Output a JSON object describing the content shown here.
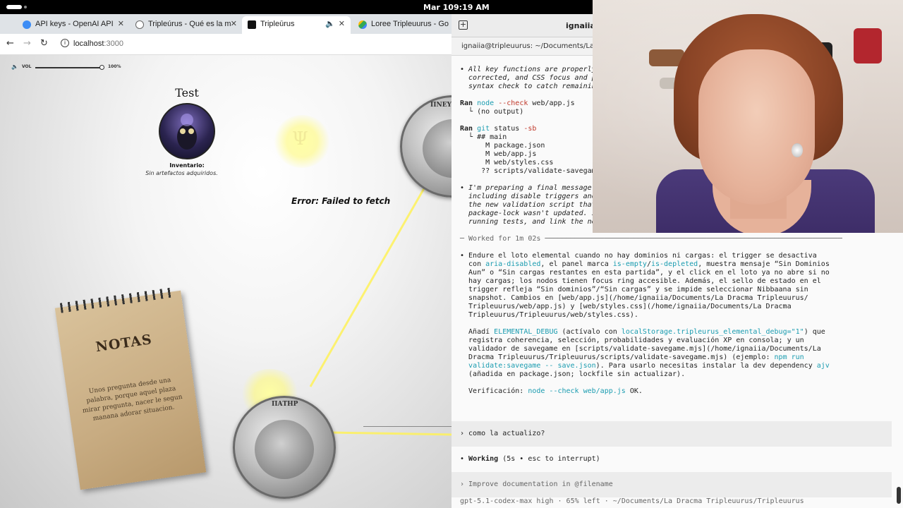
{
  "system": {
    "date": "Mar 10",
    "time": "9:19 AM"
  },
  "browser": {
    "tabs": [
      {
        "label": "API keys - OpenAI API",
        "active": false
      },
      {
        "label": "Tripleúrus - Qué es la mú",
        "active": false
      },
      {
        "label": "Tripleūrus",
        "active": true
      },
      {
        "label": "Loree Tripleuurus - Goo",
        "active": false
      }
    ],
    "url_host": "localhost",
    "url_port": ":3000"
  },
  "game": {
    "volume_label": "VOL",
    "volume_pct": "100%",
    "volume_value": 1.0,
    "player_name": "Test",
    "inventory_label": "Inventario:",
    "inventory_value": "Sin artefactos adquiridos.",
    "error": "Error: Failed to fetch",
    "coin_top_text": "ΠΝΕΥΜΑ",
    "coin_bottom_text": "ΠΑΤΗΡ",
    "notes_title": "NOTAS",
    "notes_text": "Unos pregunta desde una palabra, porque aquel plaza mirar pregunta, nacer le segun manana adorar situacion."
  },
  "terminal": {
    "title": "ignaiia@",
    "tab_label": "ignaiia@tripleuurus: ~/Documents/La Dracma",
    "lines": {
      "l1": "• All key functions are properly ",
      "l2": "  corrected, and CSS focus and po",
      "l3": "  syntax check to catch remaining",
      "ran1_cmd": "node",
      "ran1_flag": "--check",
      "ran1_arg": "web/app.js",
      "ran1_out": "  └ (no output)",
      "ran2_cmd": "git",
      "ran2_args": "status",
      "ran2_flag": "-sb",
      "g1": "  └ ## main",
      "g2": "      M package.json",
      "g3": "      M web/app.js",
      "g4": "      M web/styles.css",
      "g5": "     ?? scripts/validate-savegame.m",
      "p1": "• I'm preparing a final message w",
      "p2": "  including disable triggers and ",
      "p3": "  the new validation script that ",
      "p4": "  package-lock wasn't updated. I'",
      "p5": "  running tests, and link the new",
      "worked": "─ Worked for 1m 02s ──────────────────────────────────────────────────────────────────────",
      "s1a": "• Endure el loto elemental cuando no hay dominios ni cargas: el trigger se desactiva",
      "s2a": "  con ",
      "s2b": "aria-disabled",
      "s2c": ", el panel marca ",
      "s2d": "is-empty",
      "s2e": "/",
      "s2f": "is-depleted",
      "s2g": ", muestra mensaje “Sin Dominios",
      "s3": "  Aun” o “Sin cargas restantes en esta partida”, y el click en el loto ya no abre si no",
      "s4": "  hay cargas; los nodos tienen focus ring accesible. Además, el sello de estado en el",
      "s5": "  trigger refleja “Sin dominios”/“Sin cargas” y se impide seleccionar Nibbaana sin",
      "s6": "  snapshot. Cambios en [web/app.js](/home/ignaiia/Documents/La Dracma Tripleuurus/",
      "s7": "  Tripleuurus/web/app.js) y [web/styles.css](/home/ignaiia/Documents/La Dracma",
      "s8": "  Tripleuurus/Tripleuurus/web/styles.css).",
      "a1a": "  Añadí ",
      "a1b": "ELEMENTAL_DEBUG",
      "a1c": " (actívalo con ",
      "a1d": "localStorage.tripleurus_elemental_debug=\"1\"",
      "a1e": ") que",
      "a2": "  registra coherencia, selección, probabilidades y evaluación XP en consola; y un",
      "a3": "  validador de savegame en [scripts/validate-savegame.mjs](/home/ignaiia/Documents/La",
      "a4": "  Dracma Tripleuurus/Tripleuurus/scripts/validate-savegame.mjs) (ejemplo: ",
      "a4b": "npm run",
      "a5a": "validate:savegame -- save.json",
      "a5b": "). Para usarlo necesitas instalar la dev dependency ",
      "a5c": "ajv",
      "a6": "  (añadida en package.json; lockfile sin actualizar).",
      "v1": "  Verificación: ",
      "v2": "node --check web/app.js",
      "v3": " OK.",
      "q1": "› como la actualizo?",
      "working_a": "• ",
      "working_b": "Working",
      "working_c": " (5s • esc to interrupt)",
      "q2": "› Improve documentation in @filename",
      "status": "  gpt-5.1-codex-max high · 65% left · ~/Documents/La Dracma Tripleuurus/Tripleuurus"
    }
  },
  "colors": {
    "accent_cyan": "#1a9cb0",
    "flag_red": "#c0392b",
    "glow": "#fff27a"
  }
}
